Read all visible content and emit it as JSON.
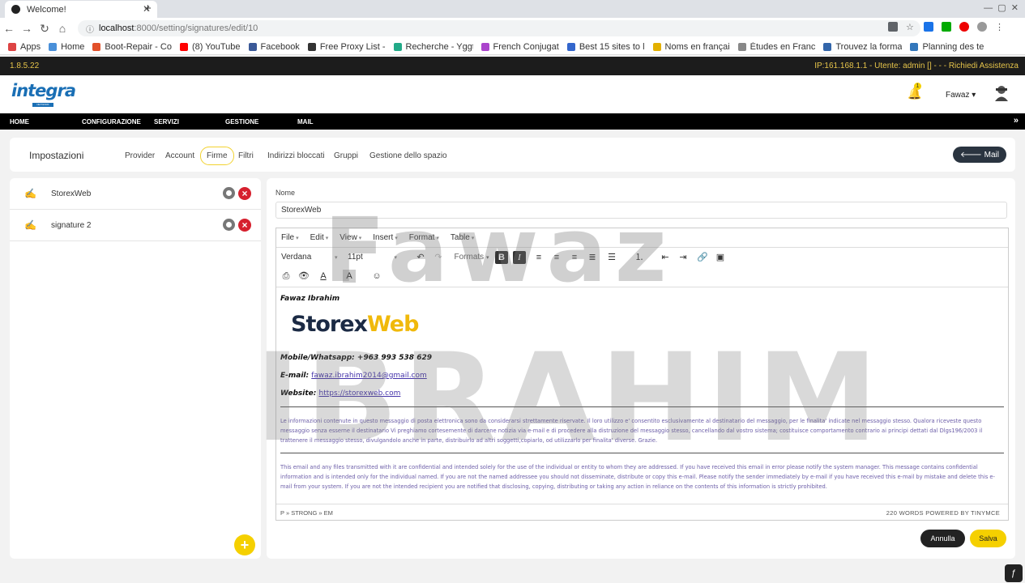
{
  "browser": {
    "tab_title": "Welcome!",
    "url_host": "localhost",
    "url_path": ":8000/setting/signatures/edit/10",
    "bookmarks": [
      {
        "label": "Apps",
        "color": "#d44"
      },
      {
        "label": "Home",
        "color": "#4a90d9"
      },
      {
        "label": "Boot-Repair - Co",
        "color": "#e2502a"
      },
      {
        "label": "(8) YouTube",
        "color": "#f00"
      },
      {
        "label": "Facebook",
        "color": "#3b5998"
      },
      {
        "label": "Free Proxy List -",
        "color": "#333"
      },
      {
        "label": "Recherche - Yggt",
        "color": "#2a8"
      },
      {
        "label": "French Conjugat",
        "color": "#a4c"
      },
      {
        "label": "Best 15 sites to l",
        "color": "#36c"
      },
      {
        "label": "Noms en françai",
        "color": "#e3b000"
      },
      {
        "label": "Études en Franc",
        "color": "#888"
      },
      {
        "label": "Trouvez la forma",
        "color": "#36a"
      },
      {
        "label": "Planning des te",
        "color": "#37b"
      }
    ]
  },
  "app": {
    "version": "1.8.5.22",
    "user_info": "IP:161.168.1.1 - Utente: admin [] - - - Richiedi Assistenza",
    "logo_text": "integra",
    "logo_sub": "NETWORK",
    "notification_count": "1",
    "username": "Fawaz",
    "nav": [
      "HOME",
      "CONFIGURAZIONE",
      "SERVIZI",
      "GESTIONE",
      "MAIL"
    ]
  },
  "settings": {
    "title": "Impostazioni",
    "tabs": [
      "Provider",
      "Account",
      "Firme",
      "Filtri",
      "Indirizzi bloccati",
      "Gruppi",
      "Gestione dello spazio"
    ],
    "active_tab": "Firme",
    "mail_button": "Mail"
  },
  "signatures": [
    {
      "name": "StorexWeb"
    },
    {
      "name": "signature 2"
    }
  ],
  "editor": {
    "name_label": "Nome",
    "name_value": "StorexWeb",
    "menus": [
      "File",
      "Edit",
      "View",
      "Insert",
      "Format",
      "Table"
    ],
    "font": "Verdana",
    "font_size": "11pt",
    "formats": "Formats",
    "content": {
      "author": "Fawaz Ibrahim",
      "logo_part1": "Storex",
      "logo_part2": "Web",
      "mobile": "Mobile/Whatsapp: +963 993 538 629",
      "email_label": "E-mail:",
      "email": "fawaz.ibrahim2014@gmail.com",
      "website_label": "Website:",
      "website": "https://storexweb.com",
      "disclaimer_it": "Le informazioni contenute in questo messaggio di posta elettronica sono da considerarsi strettamente riservate. Il loro utilizzo e' consentito esclusivamente al destinatario del messaggio, per le finalita' indicate nel messaggio stesso. Qualora riceveste questo messaggio senza esserne il destinatario Vi preghiamo cortesemente di darcene notizia via e-mail e di procedere alla distruzione del messaggio stesso, cancellando dal vostro sistema; costituisce comportamento contrario ai principi dettati dal Dlgs196/2003 il trattenere il messaggio stesso, divulgandolo anche in parte, distribuirlo ad altri soggetti,copiarlo, od utilizzarlo per finalita' diverse. Grazie.",
      "disclaimer_en": "This email and any files transmitted with it are confidential and intended solely for the use of the individual or entity to whom they are addressed. If you have received this email in error please notify the system manager. This message contains confidential information and is intended only for the individual named. If you are not the named addressee you should not disseminate, distribute or copy this e-mail. Please notify the sender immediately by e-mail if you have received this e-mail by mistake and delete this e-mail from your system. If you are not the intended recipient you are notified that disclosing, copying, distributing or taking any action in reliance on the contents of this information is strictly prohibited."
    },
    "status_path": "P » STRONG » EM",
    "status_words": "220 WORDS POWERED BY TINYMCE",
    "cancel": "Annulla",
    "save": "Salva"
  },
  "watermark": {
    "line1": "Fawaz",
    "line2": "IBRAHIM"
  }
}
